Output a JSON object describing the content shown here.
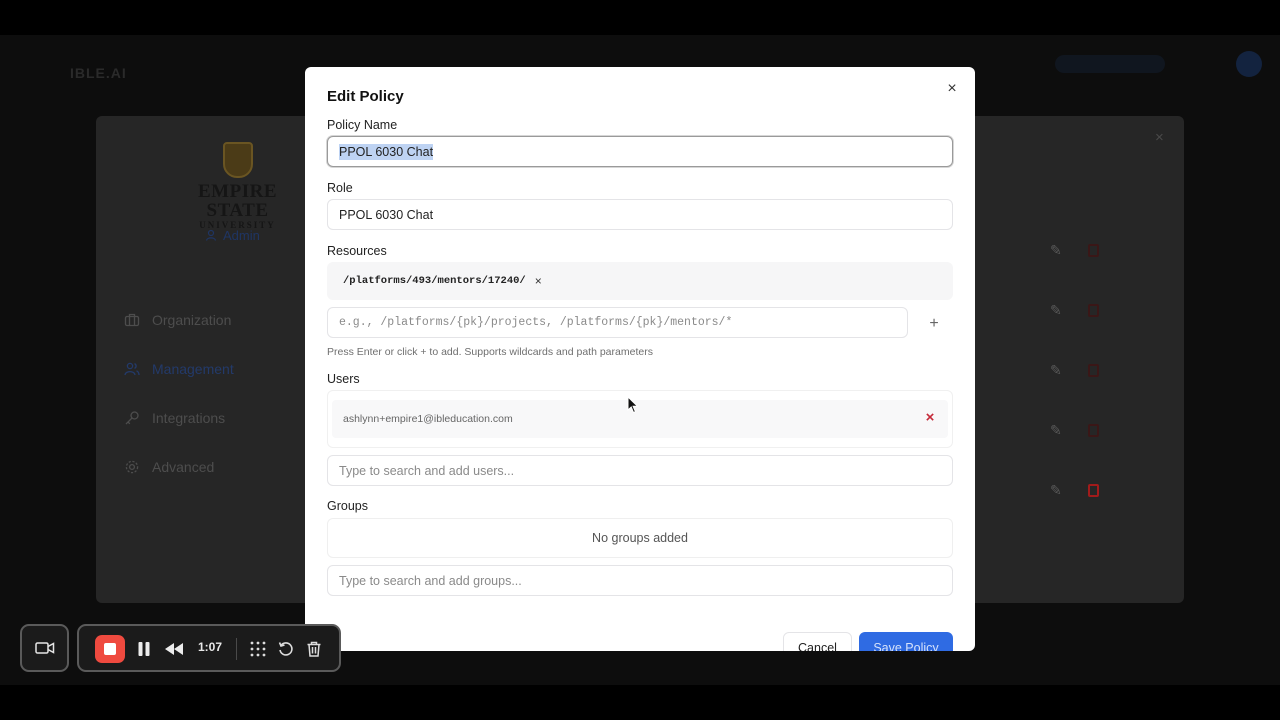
{
  "background_app": {
    "brand": "IBLE.AI",
    "logo": {
      "title": "EMPIRE STATE",
      "subtitle": "UNIVERSITY"
    },
    "role_badge": "Admin",
    "nav": [
      {
        "label": "Organization",
        "icon": "briefcase-icon"
      },
      {
        "label": "Management",
        "icon": "users-icon"
      },
      {
        "label": "Integrations",
        "icon": "key-icon"
      },
      {
        "label": "Advanced",
        "icon": "gear-icon"
      }
    ],
    "close_label": "×"
  },
  "modal": {
    "title": "Edit Policy",
    "close_label": "×",
    "policy_name": {
      "label": "Policy Name",
      "value": "PPOL 6030 Chat"
    },
    "role": {
      "label": "Role",
      "value": "PPOL 6030 Chat"
    },
    "resources": {
      "label": "Resources",
      "items": [
        "/platforms/493/mentors/17240/"
      ],
      "remove_label": "×",
      "input_placeholder": "e.g., /platforms/{pk}/projects, /platforms/{pk}/mentors/*",
      "add_label": "+",
      "hint": "Press Enter or click + to add. Supports wildcards and path parameters"
    },
    "users": {
      "label": "Users",
      "items": [
        "ashlynn+empire1@ibleducation.com"
      ],
      "remove_label": "×",
      "input_placeholder": "Type to search and add users..."
    },
    "groups": {
      "label": "Groups",
      "empty_text": "No groups added",
      "input_placeholder": "Type to search and add groups..."
    },
    "buttons": {
      "cancel": "Cancel",
      "save": "Save Policy"
    }
  },
  "recorder": {
    "timer": "1:07",
    "colors": {
      "stop": "#ef4a3f"
    }
  },
  "colors": {
    "accent": "#2f6be3",
    "danger": "#c52a3a",
    "selection": "#bed3f3"
  }
}
